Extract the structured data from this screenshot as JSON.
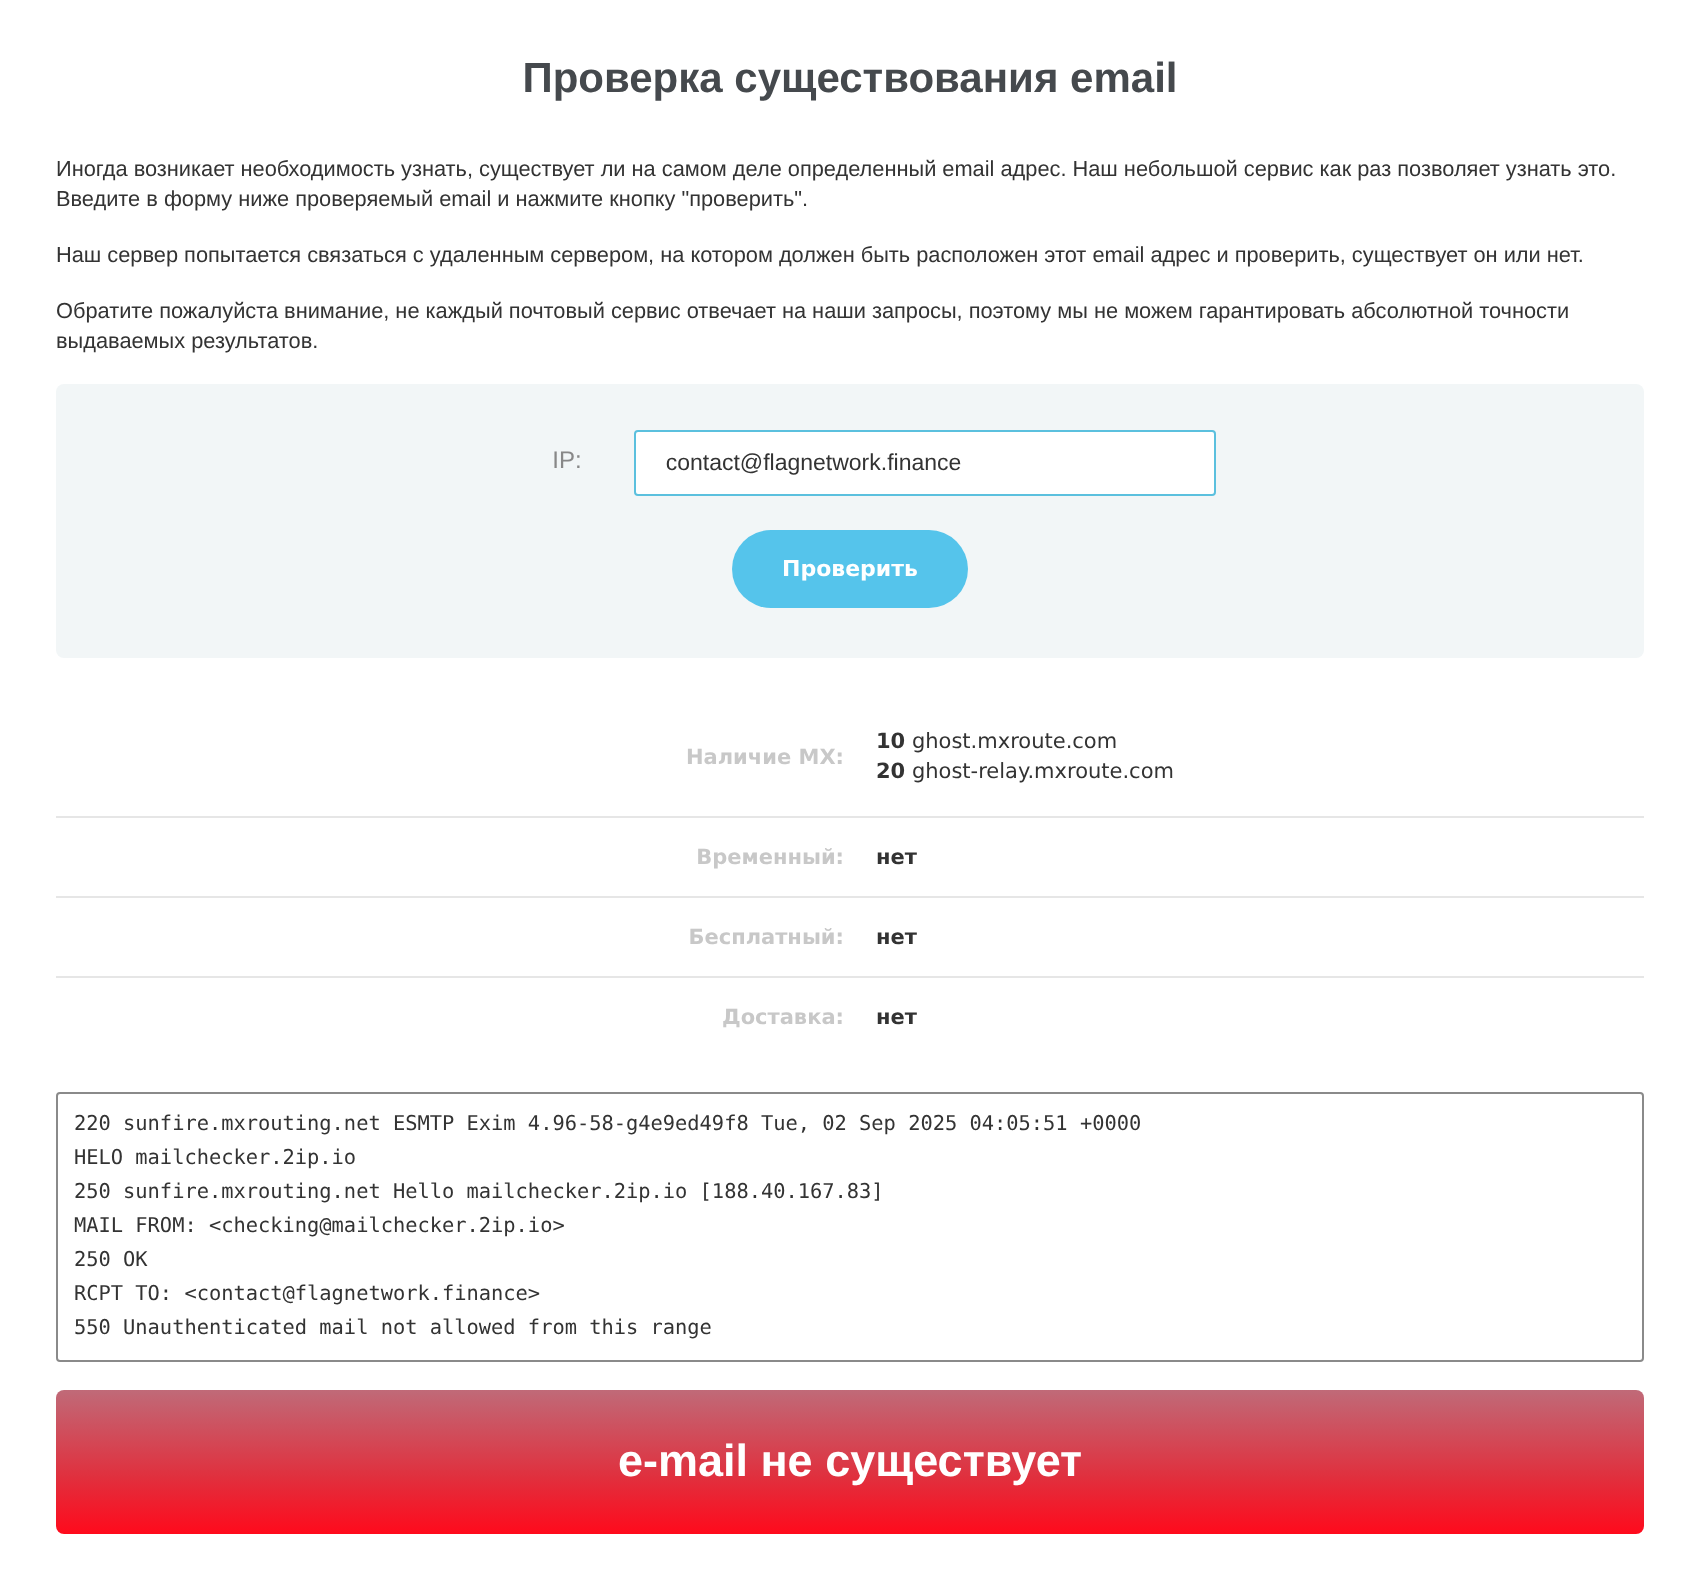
{
  "title": "Проверка существования email",
  "intro": [
    "Иногда возникает необходимость узнать, существует ли на самом деле определенный email адрес. Наш небольшой сервис как раз позволяет узнать это. Введите в форму ниже проверяемый email и нажмите кнопку \"проверить\".",
    "Наш сервер попытается связаться с удаленным сервером, на котором должен быть расположен этот email адрес и проверить, существует он или нет.",
    "Обратите пожалуйста внимание, не каждый почтовый сервис отвечает на наши запросы, поэтому мы не можем гарантировать абсолютной точности выдаваемых результатов."
  ],
  "form": {
    "label": "IP:",
    "value": "contact@flagnetwork.finance",
    "button": "Проверить"
  },
  "checks": [
    {
      "kind": "list",
      "label": "Наличие MX:",
      "lines": [
        "**10** ghost.mxroute.com",
        "**20** ghost-relay.mxroute.com"
      ]
    },
    {
      "kind": "text",
      "label": "Временный:",
      "value": "нет"
    },
    {
      "kind": "text",
      "label": "Бесплатный:",
      "value": "нет"
    },
    {
      "kind": "text",
      "label": "Доставка:",
      "value": "нет"
    }
  ],
  "log": [
    "220 sunfire.mxrouting.net ESMTP Exim 4.96-58-g4e9ed49f8 Tue, 02 Sep 2025 04:05:51 +0000",
    "HELO mailchecker.2ip.io",
    "250 sunfire.mxrouting.net Hello mailchecker.2ip.io [188.40.167.83]",
    "MAIL FROM: <checking@mailchecker.2ip.io>",
    "250 OK",
    "RCPT TO: <contact@flagnetwork.finance>",
    "550 Unauthenticated mail not allowed from this range"
  ],
  "result": {
    "exists": false,
    "text": "e-mail не существует"
  }
}
